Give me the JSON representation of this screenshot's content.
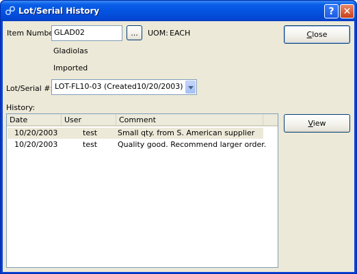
{
  "window": {
    "title": "Lot/Serial History",
    "help_glyph": "?",
    "close_glyph": "✕"
  },
  "item": {
    "label": "Item Number:",
    "value": "GLAD02",
    "lookup_label": "...",
    "uom_label": "UOM:",
    "uom_value": "EACH",
    "description1": "Gladiolas",
    "description2": "Imported"
  },
  "lot": {
    "label": "Lot/Serial #:",
    "selected": "LOT-FL10-03 (Created10/20/2003)"
  },
  "history": {
    "label": "History:",
    "columns": [
      "Date",
      "User",
      "Comment"
    ],
    "rows": [
      {
        "date": "10/20/2003",
        "user": "test",
        "comment": "Small qty. from S. American supplier"
      },
      {
        "date": "10/20/2003",
        "user": "test",
        "comment": "Quality good. Recommend larger order."
      }
    ]
  },
  "buttons": {
    "close_prefix": "",
    "close_mnemonic": "C",
    "close_rest": "lose",
    "view_prefix": "",
    "view_mnemonic": "V",
    "view_rest": "iew"
  }
}
